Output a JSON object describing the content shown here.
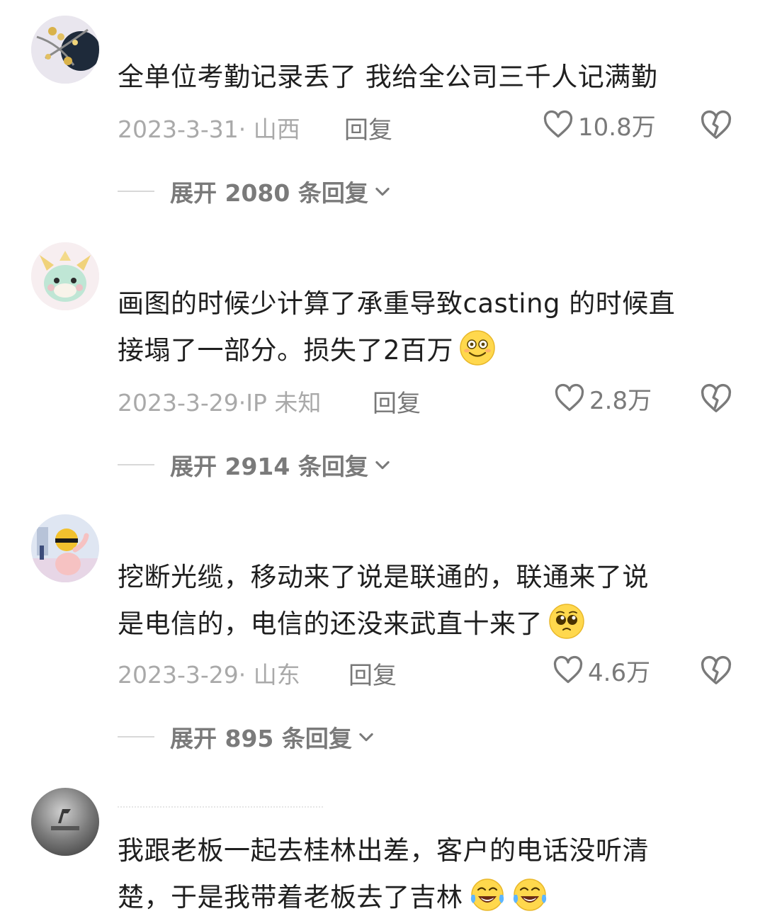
{
  "colors": {
    "text": "#1f1f1f",
    "meta": "#a9a9a9",
    "action": "#7a7a7a",
    "divider": "#d8d8d8"
  },
  "comments": [
    {
      "avatar_icon": "flower-branch-avatar",
      "lines": [
        "全单位考勤记录丢了 我给全公司三千人记满勤"
      ],
      "emojis": [],
      "date": "2023-3-31· 山西",
      "reply_label": "回复",
      "likes": "10.8万",
      "expand": "展开 2080 条回复"
    },
    {
      "avatar_icon": "cartoon-dragon-avatar",
      "lines": [
        "画图的时候少计算了承重导致casting 的时候直",
        "接塌了一部分。损失了2百万"
      ],
      "emojis": [
        "dizzy-smile-emoji"
      ],
      "date": "2023-3-29·IP 未知",
      "reply_label": "回复",
      "likes": "2.8万",
      "expand": "展开 2914 条回复"
    },
    {
      "avatar_icon": "cartoon-character-avatar",
      "lines": [
        "挖断光缆，移动来了说是联通的，联通来了说",
        "是电信的，电信的还没来武直十来了"
      ],
      "emojis": [
        "pleading-face-emoji"
      ],
      "date": "2023-3-29· 山东",
      "reply_label": "回复",
      "likes": "4.6万",
      "expand": "展开 895 条回复"
    },
    {
      "avatar_icon": "gray-logo-avatar",
      "lines": [
        "我跟老板一起去桂林出差，客户的电话没听清",
        "楚，于是我带着老板去了吉林"
      ],
      "emojis": [
        "laughing-tears-emoji",
        "laughing-tears-emoji"
      ]
    }
  ]
}
